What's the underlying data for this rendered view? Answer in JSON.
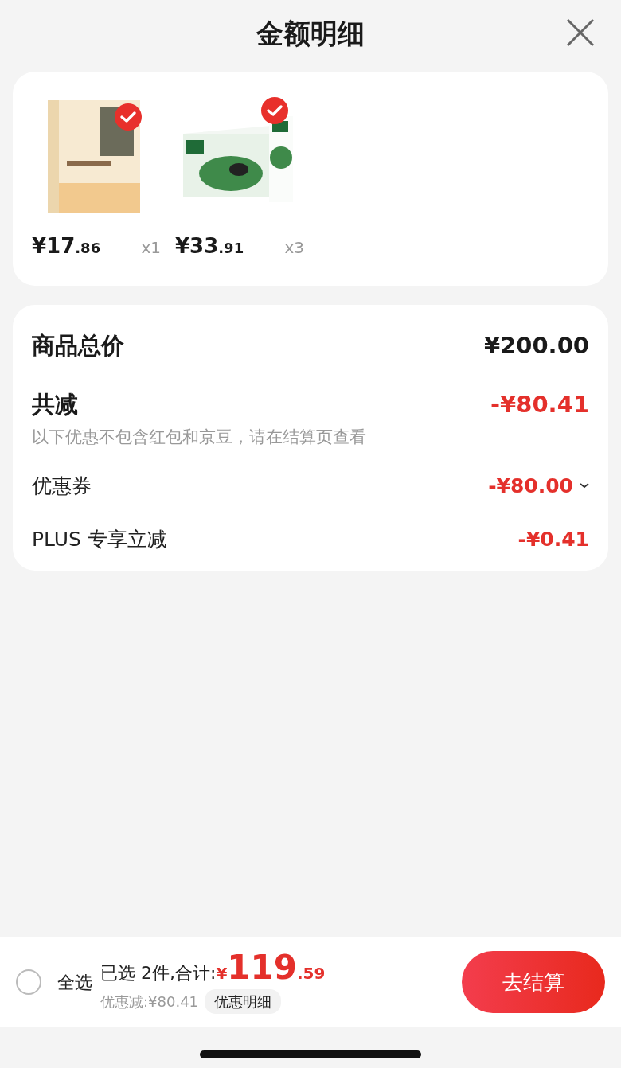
{
  "header": {
    "title": "金额明细"
  },
  "products": [
    {
      "kind": "book",
      "checked": true,
      "price_main": "¥17",
      "price_cents": ".86",
      "quantity": "x1"
    },
    {
      "kind": "milk",
      "checked": true,
      "price_main": "¥33",
      "price_cents": ".91",
      "quantity": "x3"
    }
  ],
  "summary": {
    "total_label": "商品总价",
    "total_value": "¥200.00",
    "discount_label": "共减",
    "discount_value": "-¥80.41",
    "note": "以下优惠不包含红包和京豆，请在结算页查看",
    "lines": [
      {
        "label": "优惠券",
        "value": "-¥80.00",
        "expandable": true
      },
      {
        "label": "PLUS 专享立减",
        "value": "-¥0.41",
        "expandable": false
      }
    ]
  },
  "footer": {
    "select_all": {
      "label": "全选",
      "checked": false
    },
    "selected_text": "已选 2件,合计:",
    "currency": "¥",
    "total_main": "119",
    "total_cents": ".59",
    "saved": "优惠减:¥80.41",
    "detail_button": "优惠明细",
    "checkout_button": "去结算"
  }
}
